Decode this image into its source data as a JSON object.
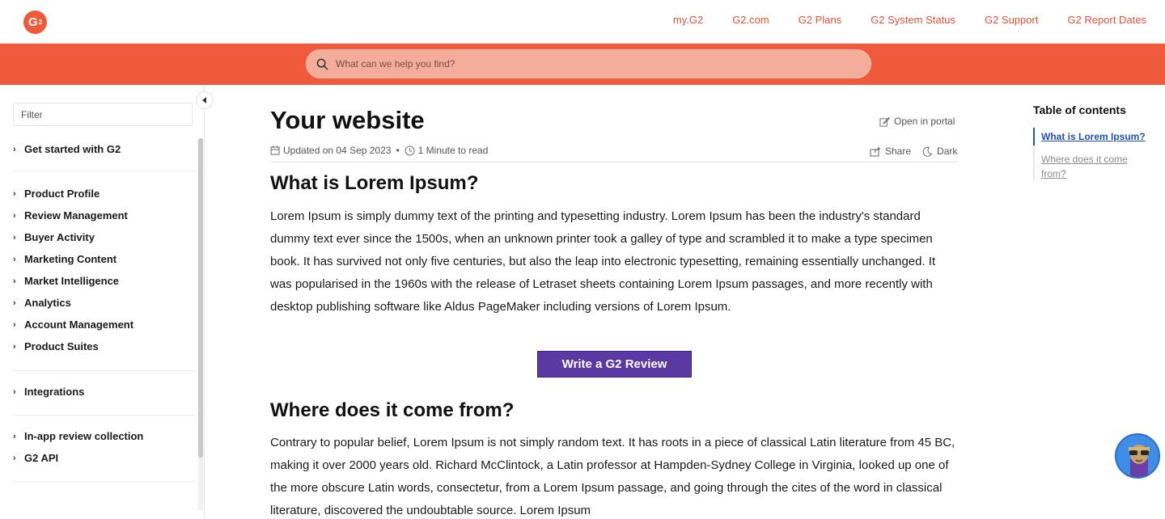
{
  "brand": {
    "logo_text": "G",
    "accent": "#ef5a3c",
    "link_color": "#e0533a",
    "button_color": "#5a39a2"
  },
  "topnav": [
    {
      "label": "my.G2"
    },
    {
      "label": "G2.com"
    },
    {
      "label": "G2 Plans"
    },
    {
      "label": "G2 System Status"
    },
    {
      "label": "G2 Support"
    },
    {
      "label": "G2 Report Dates"
    }
  ],
  "search": {
    "placeholder": "What can we help you find?",
    "icon": "search-icon"
  },
  "sidebar": {
    "filter_placeholder": "Filter",
    "items": [
      {
        "label": "Get started with G2"
      },
      {
        "label": "Product Profile"
      },
      {
        "label": "Review Management"
      },
      {
        "label": "Buyer Activity"
      },
      {
        "label": "Marketing Content"
      },
      {
        "label": "Market Intelligence"
      },
      {
        "label": "Analytics"
      },
      {
        "label": "Account Management"
      },
      {
        "label": "Product Suites"
      },
      {
        "label": "Integrations"
      },
      {
        "label": "In-app review collection"
      },
      {
        "label": "G2 API"
      }
    ]
  },
  "article": {
    "title": "Your website",
    "updated": "Updated on 04 Sep 2023",
    "read_time": "1 Minute to read",
    "open_in_portal": "Open in portal",
    "share": "Share",
    "dark": "Dark",
    "sections": [
      {
        "heading": "What is Lorem Ipsum?",
        "body": "Lorem Ipsum is simply dummy text of the printing and typesetting industry. Lorem Ipsum has been the industry's standard dummy text ever since the 1500s, when an unknown printer took a galley of type and scrambled it to make a type specimen book. It has survived not only five centuries, but also the leap into electronic typesetting, remaining essentially unchanged. It was popularised in the 1960s with the release of Letraset sheets containing Lorem Ipsum passages, and more recently with desktop publishing software like Aldus PageMaker including versions of Lorem Ipsum."
      },
      {
        "heading": "Where does it come from?",
        "body": "Contrary to popular belief, Lorem Ipsum is not simply random text. It has roots in a piece of classical Latin literature from 45 BC, making it over 2000 years old. Richard McClintock, a Latin professor at Hampden-Sydney College in Virginia, looked up one of the more obscure Latin words, consectetur, from a Lorem Ipsum passage, and going through the cites of the word in classical literature, discovered the undoubtable source. Lorem Ipsum"
      }
    ],
    "cta_label": "Write a G2 Review"
  },
  "toc": {
    "title": "Table of contents",
    "items": [
      {
        "label": "What is Lorem Ipsum?",
        "active": true
      },
      {
        "label": "Where does it come from?",
        "active": false
      }
    ]
  }
}
